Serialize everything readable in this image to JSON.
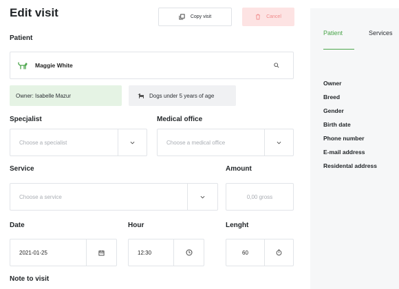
{
  "header": {
    "title": "Edit visit"
  },
  "toolbar": {
    "copy_label": "Copy visit",
    "cancel_label": "Cancel"
  },
  "patient": {
    "label": "Patient",
    "name": "Maggie White",
    "owner_chip": "Owner: Isabelle Mazur",
    "group_chip": "Dogs under 5 years of age"
  },
  "specialist": {
    "label": "Specjalist",
    "placeholder": "Choose a specialist"
  },
  "medical_office": {
    "label": "Medical office",
    "placeholder": "Choose a medical office"
  },
  "service": {
    "label": "Service",
    "placeholder": "Choose a service"
  },
  "amount": {
    "label": "Amount",
    "placeholder": "0,00 gross"
  },
  "date": {
    "label": "Date",
    "value": "2021-01-25"
  },
  "hour": {
    "label": "Hour",
    "value": "12:30"
  },
  "length": {
    "label": "Lenght",
    "value": "60"
  },
  "note": {
    "label": "Note to visit"
  },
  "side_panel": {
    "tabs": [
      {
        "label": "Patient",
        "active": true
      },
      {
        "label": "Services",
        "active": false
      }
    ],
    "fields": [
      "Owner",
      "Breed",
      "Gender",
      "Birth date",
      "Phone number",
      "E-mail address",
      "Residental address"
    ]
  },
  "colors": {
    "accent": "#4aa54a",
    "danger": "#f08a8a",
    "danger_bg": "#fde3e3",
    "owner_chip_bg": "#e5f3e4",
    "panel_bg": "#f6f7f8"
  },
  "icons": [
    "copy-icon",
    "trash-icon",
    "dog-icon",
    "search-icon",
    "chevron-down-icon",
    "calendar-icon",
    "clock-icon",
    "stopwatch-icon"
  ]
}
